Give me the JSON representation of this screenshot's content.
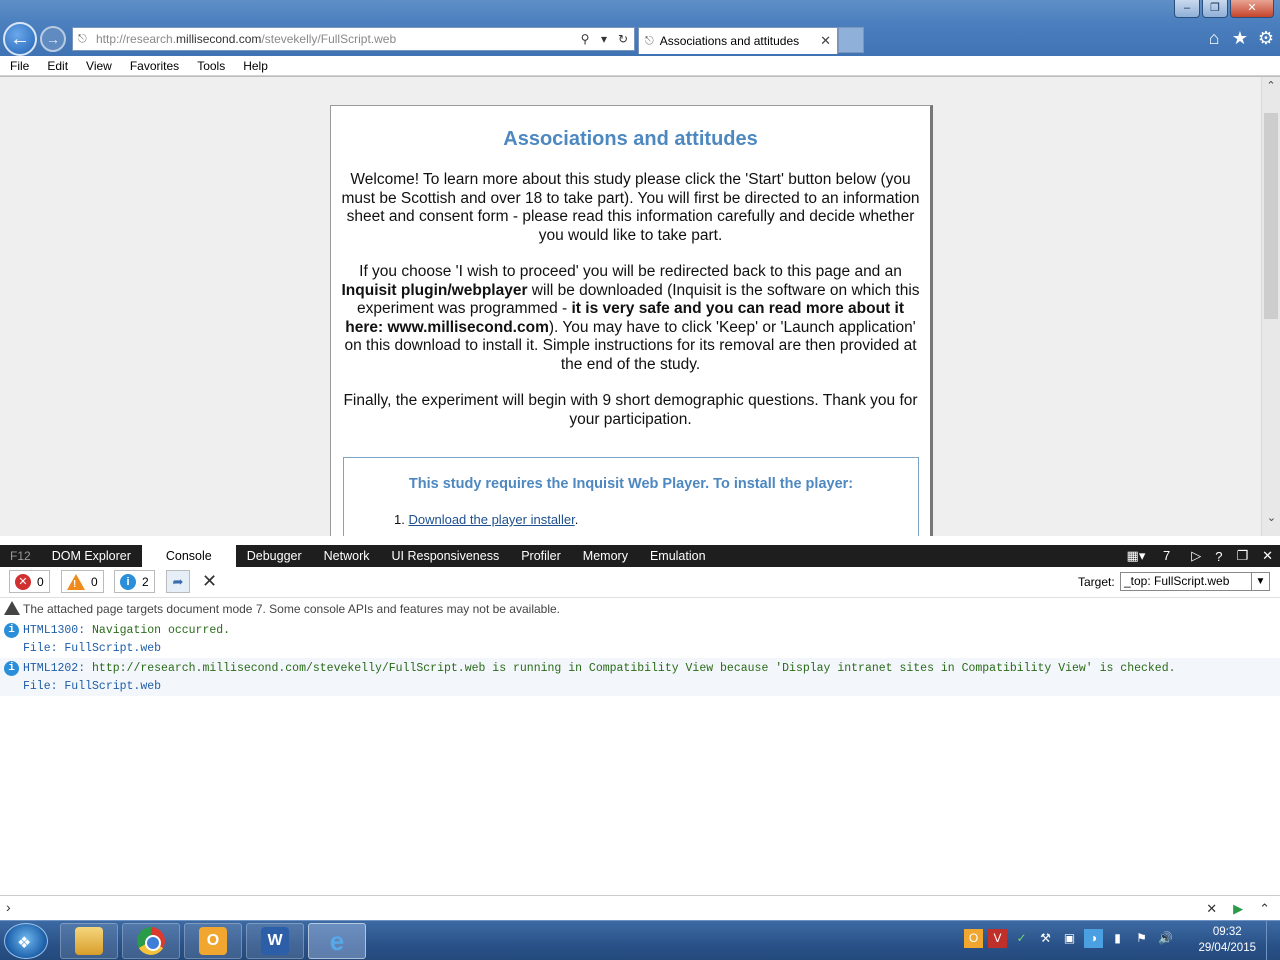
{
  "browser": {
    "url_prefix": "http://research.",
    "url_domain": "millisecond.com",
    "url_path": "/stevekelly/FullScript.web",
    "tab_title": "Associations and attitudes",
    "menu": [
      "File",
      "Edit",
      "View",
      "Favorites",
      "Tools",
      "Help"
    ]
  },
  "page": {
    "heading": "Associations and attitudes",
    "para1": "Welcome! To learn more about this study please click the 'Start' button below (you must be Scottish and over 18 to take part). You will first be directed to an information sheet and consent form - please read this information carefully and decide whether you would like to take part.",
    "para2_a": "If you choose 'I wish to proceed' you will be redirected back to this page and an ",
    "para2_b": "Inquisit plugin/webplayer",
    "para2_c": " will be downloaded (Inquisit is the software on which this experiment was programmed - ",
    "para2_d": "it is very safe and you can read more about it here: www.millisecond.com",
    "para2_e": "). You may have to click 'Keep' or 'Launch application' on this download to install it. Simple instructions for its removal are then provided at the end of the study.",
    "para3": "Finally, the experiment will begin with 9 short demographic questions. Thank you for your participation.",
    "install_title": "This study requires the Inquisit Web Player. To install the player:",
    "install_step_num": "1.",
    "install_link": "Download the player installer",
    "install_link_suffix": "."
  },
  "devtools": {
    "f12": "F12",
    "tabs": [
      "DOM Explorer",
      "Console",
      "Debugger",
      "Network",
      "UI Responsiveness",
      "Profiler",
      "Memory",
      "Emulation"
    ],
    "doc_mode": "7",
    "errors": "0",
    "warnings": "0",
    "info": "2",
    "target_label": "Target:",
    "target_value": "_top: FullScript.web",
    "messages": {
      "m1": "The attached page targets document mode 7. Some console APIs and features may not be available.",
      "m2_code": "HTML1300:",
      "m2_text": "Navigation occurred.",
      "m2_file": "File: FullScript.web",
      "m3_code": "HTML1202:",
      "m3_text": "http://research.millisecond.com/stevekelly/FullScript.web is running in Compatibility View because 'Display intranet sites in Compatibility View' is checked.",
      "m3_file": "File: FullScript.web"
    }
  },
  "taskbar": {
    "time": "09:32",
    "date": "29/04/2015"
  }
}
